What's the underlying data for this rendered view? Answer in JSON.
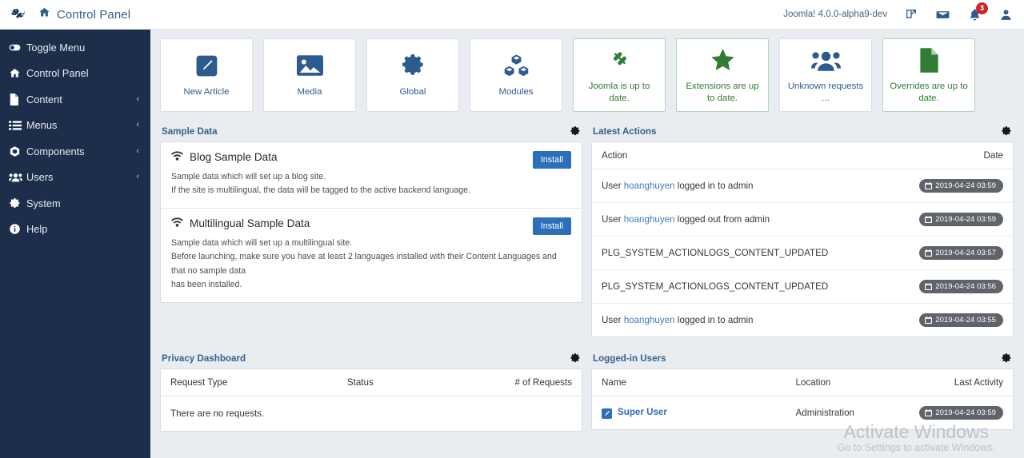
{
  "topbar": {
    "logo_icon": "joomla-logo-icon",
    "home_icon": "home-icon",
    "title": "Control Panel",
    "version": "Joomla! 4.0.0-alpha9-dev",
    "preview_icon": "external-link-icon",
    "messages_icon": "envelope-icon",
    "notifications_icon": "bell-icon",
    "notifications_count": "3",
    "user_icon": "user-icon"
  },
  "sidebar": {
    "items": [
      {
        "label": "Toggle Menu",
        "icon": "toggle-icon",
        "caret": ""
      },
      {
        "label": "Control Panel",
        "icon": "home-icon",
        "caret": ""
      },
      {
        "label": "Content",
        "icon": "file-icon",
        "caret": "‹"
      },
      {
        "label": "Menus",
        "icon": "list-icon",
        "caret": "‹"
      },
      {
        "label": "Components",
        "icon": "box-icon",
        "caret": "‹"
      },
      {
        "label": "Users",
        "icon": "users-icon",
        "caret": "‹"
      },
      {
        "label": "System",
        "icon": "gear-icon",
        "caret": ""
      },
      {
        "label": "Help",
        "icon": "info-icon",
        "caret": ""
      }
    ]
  },
  "quick_cards": [
    {
      "label": "New Article",
      "icon": "pencil-square-icon",
      "state": "blue"
    },
    {
      "label": "Media",
      "icon": "image-icon",
      "state": "blue"
    },
    {
      "label": "Global",
      "icon": "gear-icon",
      "state": "blue"
    },
    {
      "label": "Modules",
      "icon": "cubes-icon",
      "state": "blue"
    },
    {
      "label": "Joomla is up to date.",
      "icon": "joomla-logo-icon",
      "state": "green"
    },
    {
      "label": "Extensions are up to date.",
      "icon": "star-icon",
      "state": "green"
    },
    {
      "label": "Unknown requests ...",
      "icon": "users-icon",
      "state": "blue"
    },
    {
      "label": "Overrides are up to date.",
      "icon": "file-icon",
      "state": "green"
    }
  ],
  "sample_data": {
    "title": "Sample Data",
    "gear_icon": "gear-icon",
    "items": [
      {
        "icon": "wifi-icon",
        "name": "Blog Sample Data",
        "desc_line1": "Sample data which will set up a blog site.",
        "desc_line2": "If the site is multilingual, the data will be tagged to the active backend language.",
        "desc_line3": "",
        "button": "Install"
      },
      {
        "icon": "wifi-icon",
        "name": "Multilingual Sample Data",
        "desc_line1": "Sample data which will set up a multilingual site.",
        "desc_line2": "Before launching, make sure you have at least 2 languages installed with their Content Languages and that no sample data",
        "desc_line3": "has been installed.",
        "button": "Install"
      }
    ]
  },
  "latest_actions": {
    "title": "Latest Actions",
    "gear_icon": "gear-icon",
    "columns": [
      "Action",
      "Date"
    ],
    "rows": [
      {
        "prefix": "User ",
        "user": "hoanghuyen",
        "suffix": " logged in to admin",
        "date": "2019-04-24 03:59"
      },
      {
        "prefix": "User ",
        "user": "hoanghuyen",
        "suffix": " logged out from admin",
        "date": "2019-04-24 03:59"
      },
      {
        "prefix": "PLG_SYSTEM_ACTIONLOGS_CONTENT_UPDATED",
        "user": "",
        "suffix": "",
        "date": "2019-04-24 03:57"
      },
      {
        "prefix": "PLG_SYSTEM_ACTIONLOGS_CONTENT_UPDATED",
        "user": "",
        "suffix": "",
        "date": "2019-04-24 03:56"
      },
      {
        "prefix": "User ",
        "user": "hoanghuyen",
        "suffix": " logged in to admin",
        "date": "2019-04-24 03:55"
      }
    ]
  },
  "privacy_dashboard": {
    "title": "Privacy Dashboard",
    "gear_icon": "gear-icon",
    "columns": [
      "Request Type",
      "Status",
      "# of Requests"
    ],
    "empty_message": "There are no requests."
  },
  "logged_in_users": {
    "title": "Logged-in Users",
    "gear_icon": "gear-icon",
    "columns": [
      "Name",
      "Location",
      "Last Activity"
    ],
    "rows": [
      {
        "edit_icon": "edit-icon",
        "name": "Super User",
        "location": "Administration",
        "last_activity": "2019-04-24 03:59"
      }
    ]
  },
  "watermark": {
    "line1": "Activate Windows",
    "line2": "Go to Settings to activate Windows."
  },
  "colors": {
    "sidebar_bg": "#1c2e4a",
    "content_bg": "#e9ecf1",
    "accent_blue": "#2b70b9",
    "link_blue": "#3f7bbf",
    "green": "#2f7d32",
    "badge_red": "#c8262a",
    "pill_gray": "#5f636a"
  }
}
